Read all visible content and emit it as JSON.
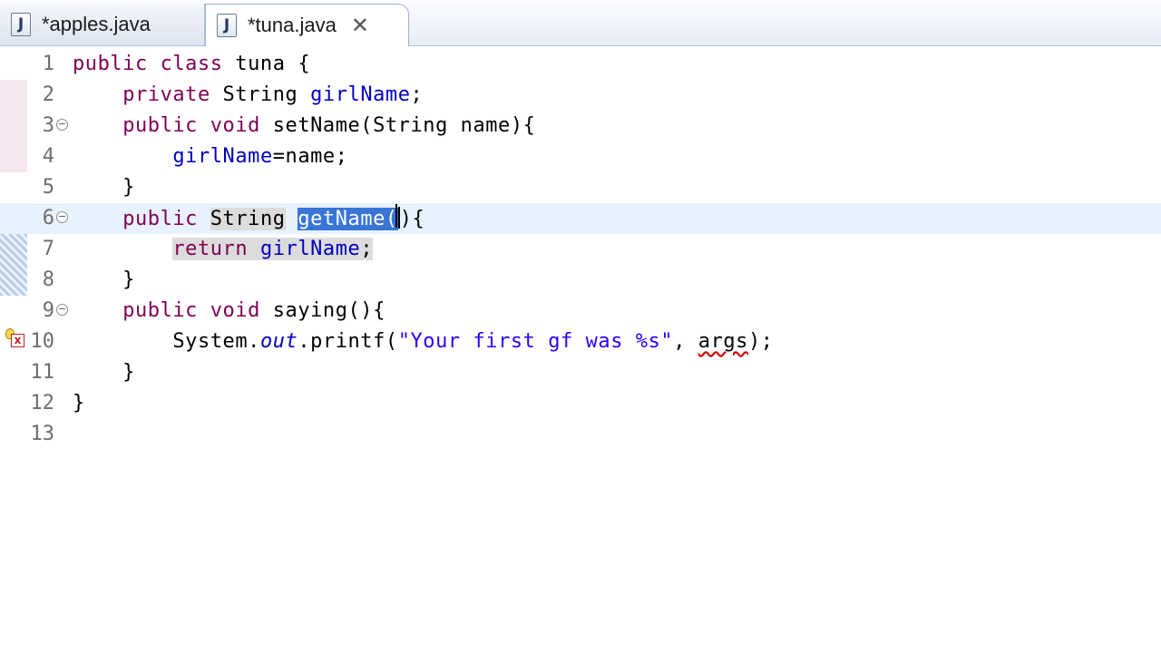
{
  "tabs": [
    {
      "label": "*apples.java",
      "icon": "java-file-icon",
      "active": false
    },
    {
      "label": "*tuna.java",
      "icon": "java-file-icon",
      "active": true,
      "close_glyph": "✕"
    }
  ],
  "editor": {
    "icon_letter": "J",
    "lines": [
      {
        "num": "1",
        "code": "public class tuna {"
      },
      {
        "num": "2",
        "code": "    private String girlName;"
      },
      {
        "num": "3",
        "code": "    public void setName(String name){"
      },
      {
        "num": "4",
        "code": "        girlName=name;"
      },
      {
        "num": "5",
        "code": "    }"
      },
      {
        "num": "6",
        "code": "    public String getName(){"
      },
      {
        "num": "7",
        "code": "        return girlName;"
      },
      {
        "num": "8",
        "code": "    }"
      },
      {
        "num": "9",
        "code": "    public void saying(){"
      },
      {
        "num": "10",
        "code": "        System.out.printf(\"Your first gf was %s\", args);"
      },
      {
        "num": "11",
        "code": "    }"
      },
      {
        "num": "12",
        "code": "}"
      },
      {
        "num": "13",
        "code": ""
      }
    ],
    "selected_text": "getName(",
    "error_text": "args",
    "error_line": "10",
    "fold_glyph": "⊖",
    "error_glyph": "x"
  }
}
